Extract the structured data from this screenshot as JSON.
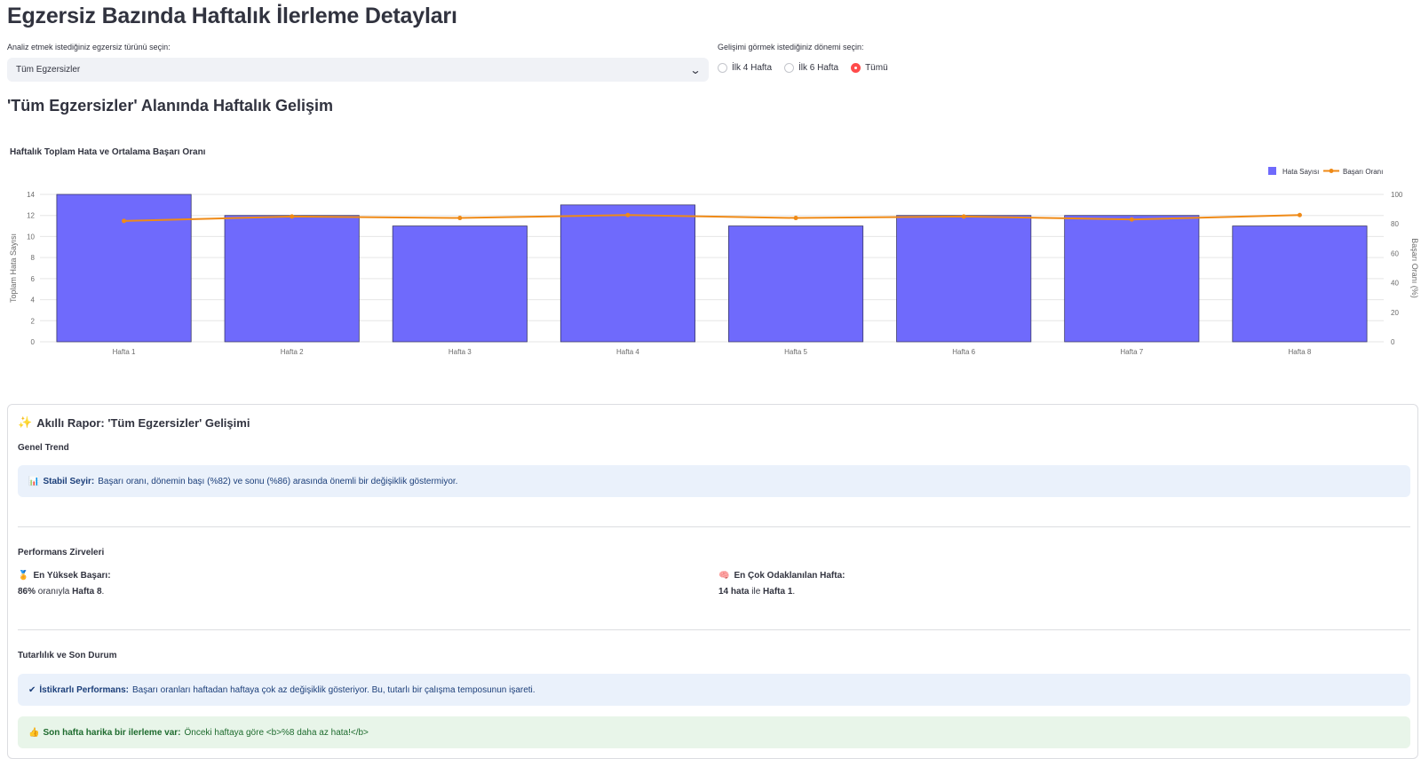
{
  "page": {
    "title": "Egzersiz Bazında Haftalık İlerleme Detayları"
  },
  "filters": {
    "exercise_label": "Analiz etmek istediğiniz egzersiz türünü seçin:",
    "exercise_selected": "Tüm Egzersizler",
    "period_label": "Gelişimi görmek istediğiniz dönemi seçin:",
    "period_options": [
      "İlk 4 Hafta",
      "İlk 6 Hafta",
      "Tümü"
    ],
    "period_selected": "Tümü"
  },
  "section": {
    "title": "'Tüm Egzersizler' Alanında Haftalık Gelişim"
  },
  "chart_data": {
    "type": "bar",
    "title": "Haftalık Toplam Hata ve Ortalama Başarı Oranı",
    "categories": [
      "Hafta 1",
      "Hafta 2",
      "Hafta 3",
      "Hafta 4",
      "Hafta 5",
      "Hafta 6",
      "Hafta 7",
      "Hafta 8"
    ],
    "series": [
      {
        "name": "Hata Sayısı",
        "type": "bar",
        "axis": "left",
        "color": "#6f6afc",
        "values": [
          14,
          12,
          11,
          13,
          11,
          12,
          12,
          11
        ]
      },
      {
        "name": "Başarı Oranı",
        "type": "line",
        "axis": "right",
        "color": "#ef8a17",
        "values": [
          82,
          85,
          84,
          86,
          84,
          85,
          83,
          86
        ]
      }
    ],
    "ylabel": "Toplam Hata Sayısı",
    "ylabel_right": "Başarı Oranı (%)",
    "ylim": [
      0,
      14
    ],
    "ylim_right": [
      0,
      100
    ],
    "yticks": [
      0,
      2,
      4,
      6,
      8,
      10,
      12,
      14
    ],
    "yticks_right": [
      0,
      20,
      40,
      60,
      80,
      100
    ],
    "grid": true,
    "legend_position": "top-right"
  },
  "report": {
    "icon": "sparkles-icon",
    "title": "Akıllı Rapor: 'Tüm Egzersizler' Gelişimi",
    "trend_heading": "Genel Trend",
    "trend_alert_icon": "bar-chart-icon",
    "trend_alert_bold": "Stabil Seyir:",
    "trend_alert_text": "Başarı oranı, dönemin başı (%82) ve sonu (%86) arasında önemli bir değişiklik göstermiyor.",
    "peaks_heading": "Performans Zirveleri",
    "best_icon": "medal-icon",
    "best_label": "En Yüksek Başarı:",
    "best_value_bold1": "86%",
    "best_value_text": " oranıyla ",
    "best_value_bold2": "Hafta 8",
    "best_value_end": ".",
    "focus_icon": "brain-icon",
    "focus_label": "En Çok Odaklanılan Hafta:",
    "focus_value_bold1": "14 hata",
    "focus_value_text": " ile ",
    "focus_value_bold2": "Hafta 1",
    "focus_value_end": ".",
    "consistency_heading": "Tutarlılık ve Son Durum",
    "consistency_icon": "check-icon",
    "consistency_bold": "İstikrarlı Performans:",
    "consistency_text": "Başarı oranları haftadan haftaya çok az değişiklik gösteriyor. Bu, tutarlı bir çalışma temposunun işareti.",
    "last_icon": "thumbs-up-icon",
    "last_bold": "Son hafta harika bir ilerleme var:",
    "last_text": "Önceki haftaya göre <b>%8 daha az hata!</b>"
  },
  "colors": {
    "accent": "#ff4b4b",
    "bar": "#6f6afc",
    "line": "#ef8a17",
    "info_bg": "#eaf1fb",
    "success_bg": "#e8f5e9"
  }
}
